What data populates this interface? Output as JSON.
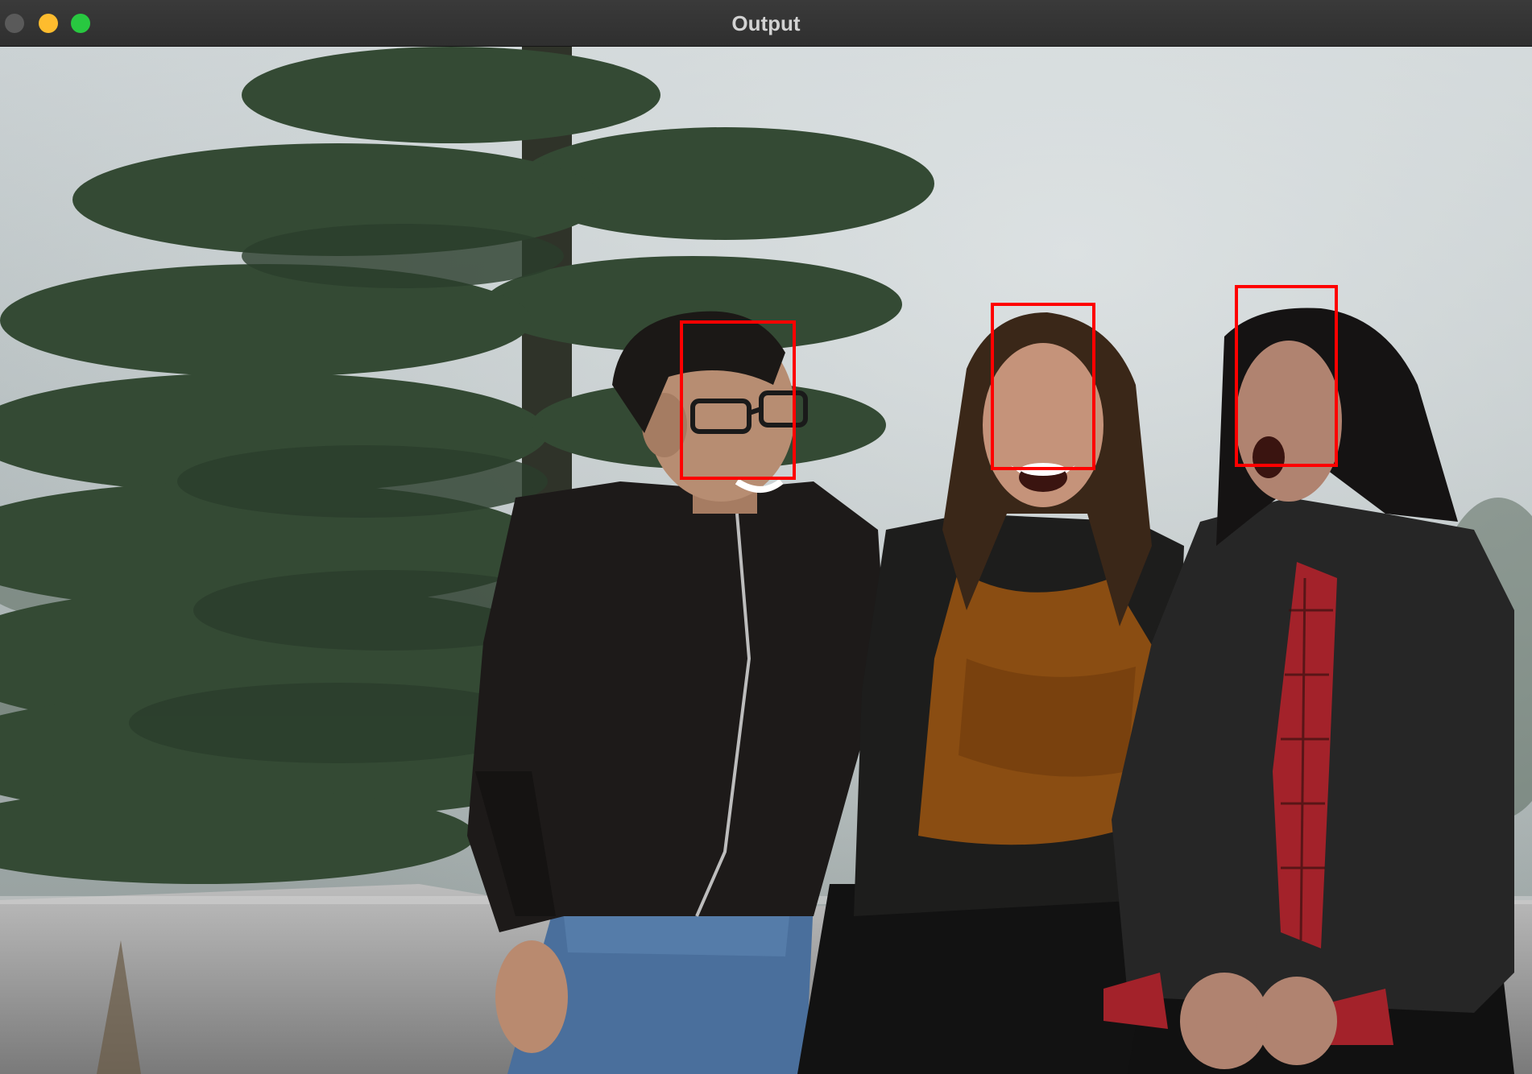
{
  "window": {
    "title": "Output",
    "controls": [
      "close-button",
      "minimize-button",
      "maximize-button"
    ]
  },
  "detection": {
    "box_color": "#ff0000",
    "face_count": 3
  }
}
